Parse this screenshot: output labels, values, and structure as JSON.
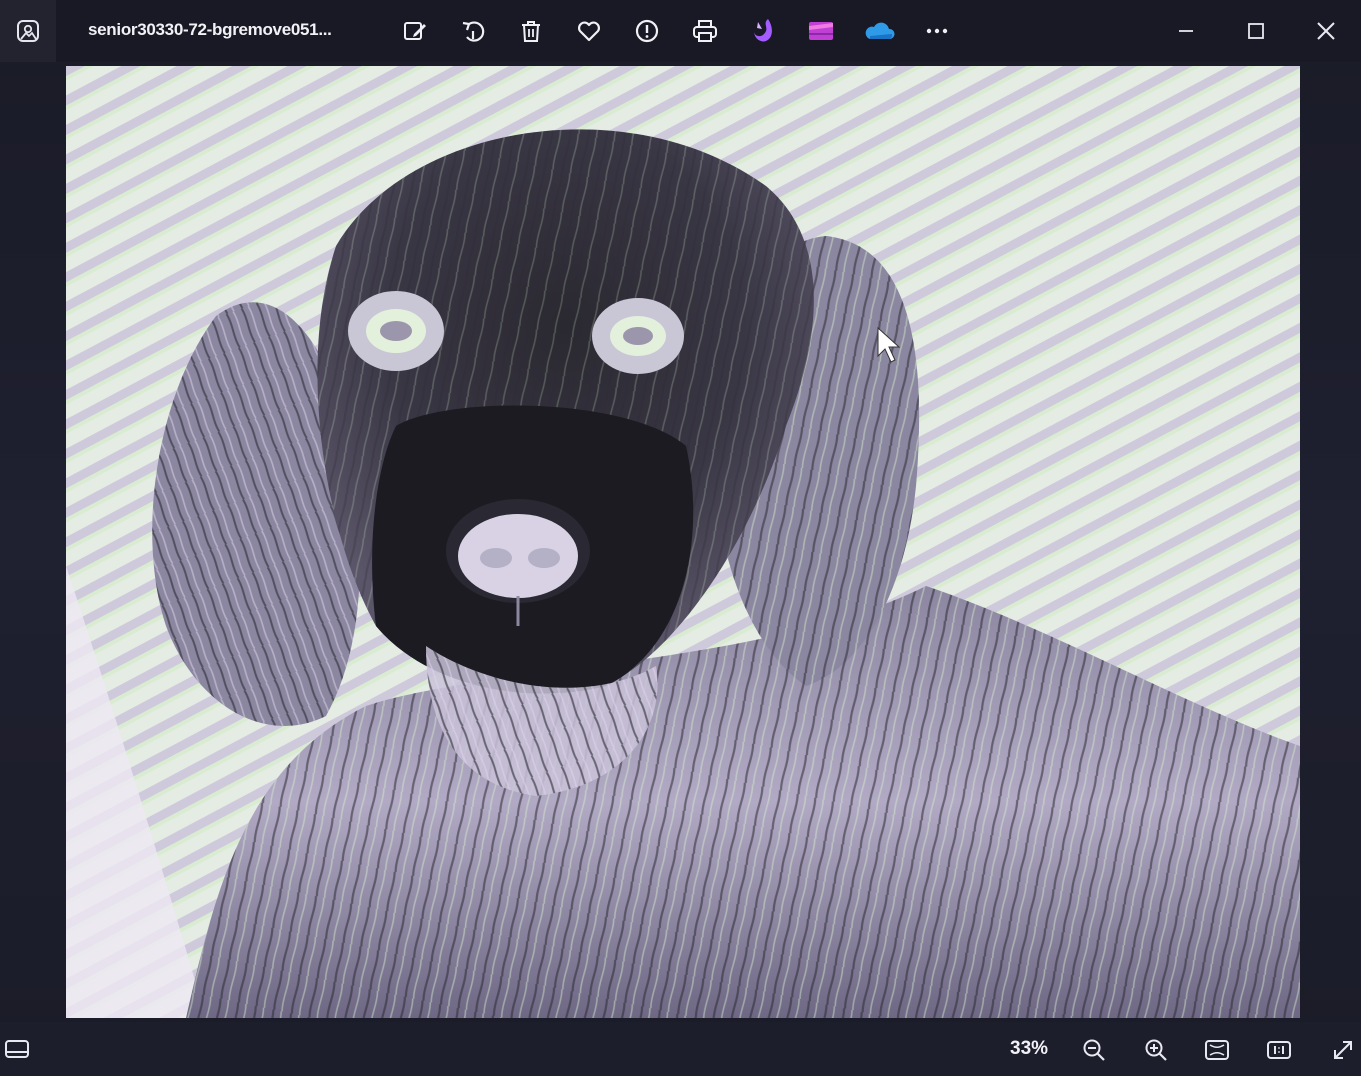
{
  "window": {
    "title": "senior30330-72-bgremove051..."
  },
  "toolbar": {
    "items": [
      {
        "name": "edit-image-icon",
        "label": "Edit image"
      },
      {
        "name": "rotate-icon",
        "label": "Rotate"
      },
      {
        "name": "delete-icon",
        "label": "Delete"
      },
      {
        "name": "heart-icon",
        "label": "Favorite"
      },
      {
        "name": "info-icon",
        "label": "File info"
      },
      {
        "name": "print-icon",
        "label": "Print"
      },
      {
        "name": "clipchamp-icon",
        "label": "Clipchamp"
      },
      {
        "name": "video-editor-icon",
        "label": "Video editor"
      },
      {
        "name": "onedrive-cloud-icon",
        "label": "OneDrive"
      },
      {
        "name": "more-options-icon",
        "label": "See more"
      }
    ]
  },
  "statusbar": {
    "zoom_level": "33%"
  },
  "colors": {
    "titlebar": "#181925",
    "text": "#f2f2f6",
    "clipchamp": "#9b4dff",
    "video_editor": "#c23fd9",
    "onedrive": "#2f9be8"
  }
}
